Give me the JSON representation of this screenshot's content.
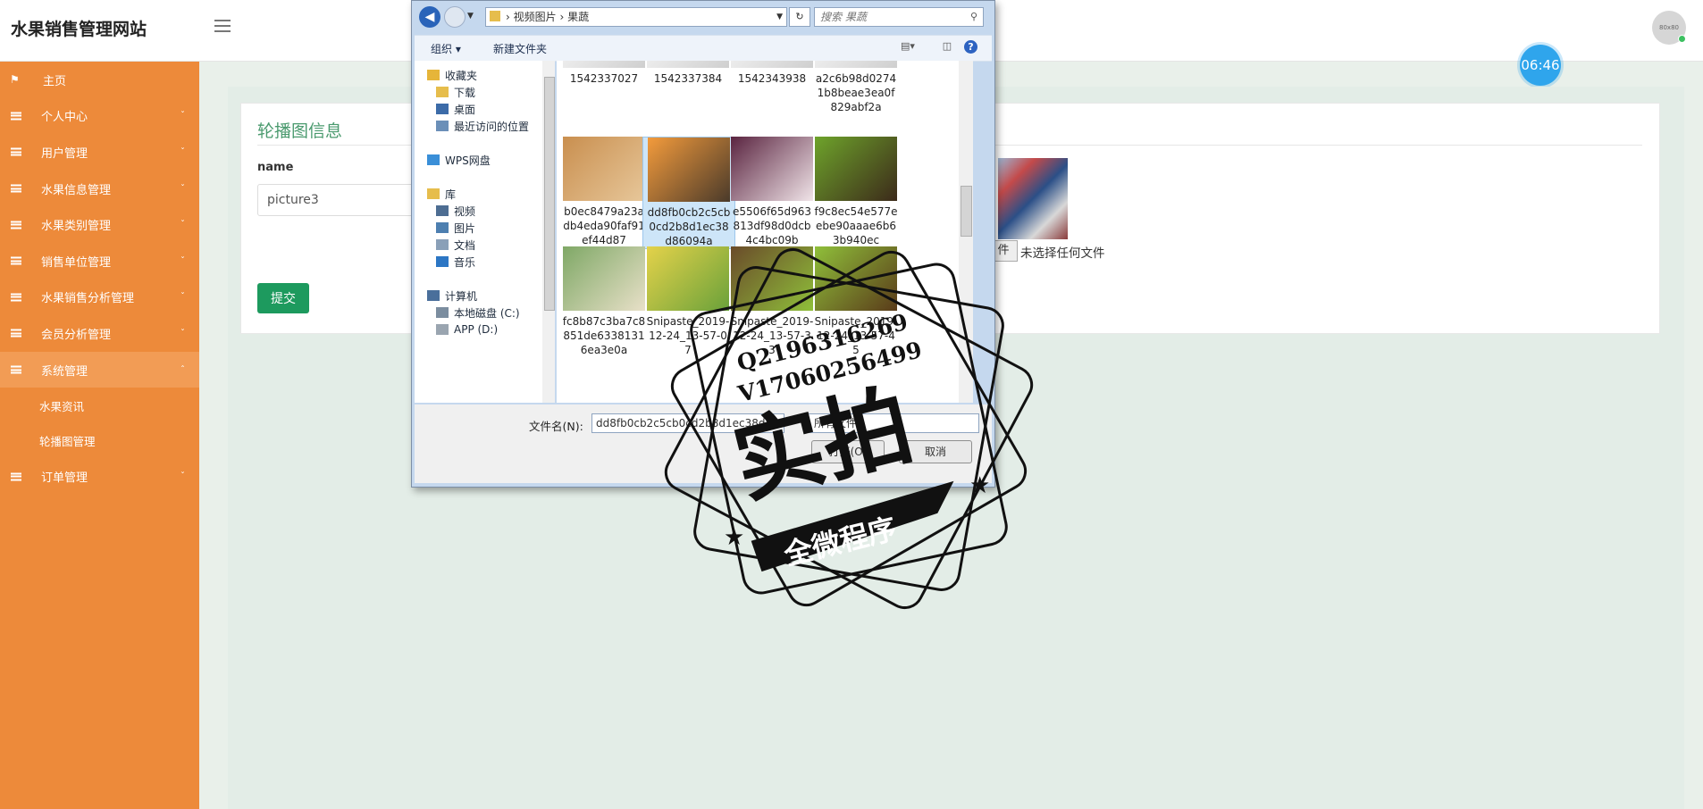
{
  "header": {
    "site_title": "水果销售管理网站",
    "avatar_text": "80x80",
    "clock": "06:46"
  },
  "sidebar": {
    "items": [
      {
        "label": "主页",
        "icon": "flag-icon"
      },
      {
        "label": "个人中心",
        "arrow": "ˇ"
      },
      {
        "label": "用户管理",
        "arrow": "ˇ"
      },
      {
        "label": "水果信息管理",
        "arrow": "ˇ"
      },
      {
        "label": "水果类别管理",
        "arrow": "ˇ"
      },
      {
        "label": "销售单位管理",
        "arrow": "ˇ"
      },
      {
        "label": "水果销售分析管理",
        "arrow": "ˇ"
      },
      {
        "label": "会员分析管理",
        "arrow": "ˇ"
      },
      {
        "label": "系统管理",
        "arrow": "ˆ"
      }
    ],
    "sub_items": [
      "水果资讯",
      "轮播图管理"
    ],
    "last_item": {
      "label": "订单管理",
      "arrow": "ˇ"
    }
  },
  "form": {
    "title": "轮播图信息",
    "field_label": "name",
    "field_value": "picture3",
    "submit_label": "提交",
    "file_button_partial": "件",
    "file_none_text": "未选择任何文件"
  },
  "dialog": {
    "path": [
      "视频图片",
      "果蔬"
    ],
    "search_placeholder": "搜索 果蔬",
    "toolbar": {
      "organize": "组织 ▾",
      "new_folder": "新建文件夹",
      "help": "?"
    },
    "nav": [
      {
        "label": "收藏夹",
        "color": "#e6b53a"
      },
      {
        "label": "下载",
        "color": "#e6bd4c"
      },
      {
        "label": "桌面",
        "color": "#3c6ba8"
      },
      {
        "label": "最近访问的位置",
        "color": "#6b8fb8"
      },
      {
        "label": "WPS网盘",
        "color": "#3a8fd8"
      },
      {
        "label": "库",
        "color": "#e6bd4c"
      },
      {
        "label": "视频",
        "color": "#4d6d92"
      },
      {
        "label": "图片",
        "color": "#4d7fb0"
      },
      {
        "label": "文档",
        "color": "#8aa0b8"
      },
      {
        "label": "音乐",
        "color": "#2c76c4"
      },
      {
        "label": "计算机",
        "color": "#4a6f9b"
      },
      {
        "label": "本地磁盘 (C:)",
        "color": "#7b8d9f"
      },
      {
        "label": "APP (D:)",
        "color": "#9aa5b0"
      }
    ],
    "files": [
      {
        "name": "1542337027",
        "colors": [
          "#f2f2f2",
          "#cfcfcf"
        ]
      },
      {
        "name": "1542337384",
        "colors": [
          "#f2f2f2",
          "#cfcfcf"
        ]
      },
      {
        "name": "1542343938",
        "colors": [
          "#f2f2f2",
          "#cfcfcf"
        ]
      },
      {
        "name": "a2c6b98d02741b8beae3ea0f829abf2a",
        "colors": [
          "#f2f2f2",
          "#cfcfcf"
        ]
      },
      {
        "name": "b0ec8479a23adb4eda90faf91ef44d87",
        "colors": [
          "#c98f4f",
          "#e7c79a"
        ]
      },
      {
        "name": "dd8fb0cb2c5cb0cd2b8d1ec38d86094a",
        "colors": [
          "#f39b3c",
          "#4a3a2a"
        ]
      },
      {
        "name": "e5506f65d963813df98d0dcb4c4bc09b",
        "colors": [
          "#5a2440",
          "#f0e4e8"
        ]
      },
      {
        "name": "f9c8ec54e577eebe90aaae6b63b940ec",
        "colors": [
          "#6ea32b",
          "#3c2a1a"
        ]
      },
      {
        "name": "fc8b87c3ba7c8851de63381316ea3e0a",
        "colors": [
          "#7fa866",
          "#e8e0c8"
        ]
      },
      {
        "name": "Snipaste_2019-12-24_13-57-07",
        "colors": [
          "#e4d24a",
          "#6aa13a"
        ]
      },
      {
        "name": "Snipaste_2019-12-24_13-57-33",
        "colors": [
          "#6a4b2a",
          "#8fbf3a"
        ]
      },
      {
        "name": "Snipaste_2019-12-24_13-57-45",
        "colors": [
          "#8fbf3a",
          "#5a3b1a"
        ]
      }
    ],
    "filename_label": "文件名(N):",
    "filename_value": "dd8fb0cb2c5cb0cd2b8d1ec38d86094a",
    "filetype_value": "所有文件",
    "open_label": "打开(O)",
    "cancel_label": "取消"
  },
  "watermark": {
    "line1": "Q2196316269",
    "line2": "V17060256499",
    "main": "实拍",
    "ribbon": "全微程序"
  }
}
